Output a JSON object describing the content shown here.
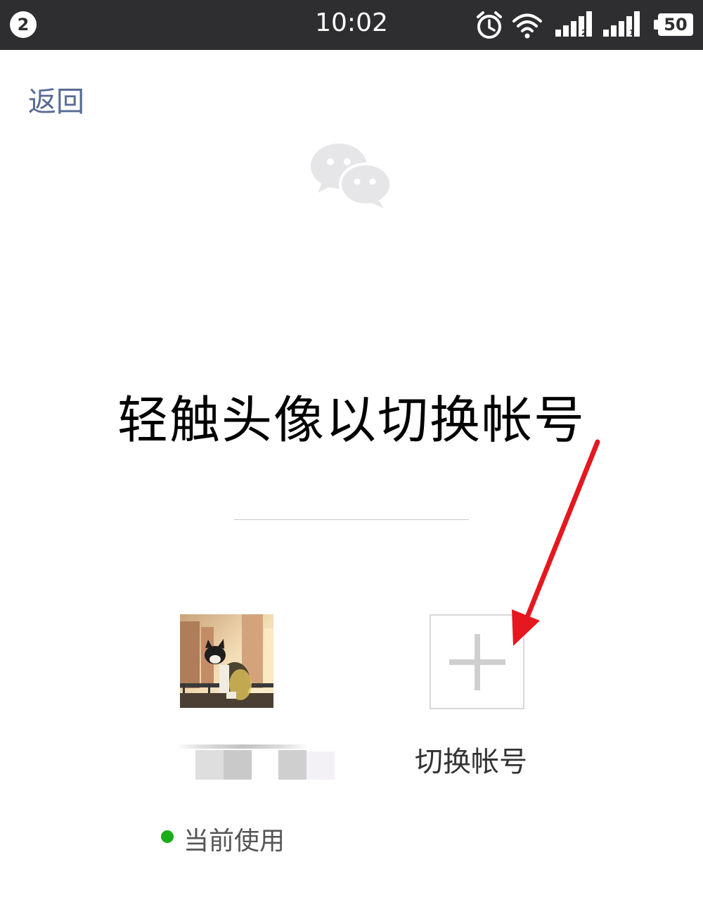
{
  "status_bar": {
    "notification_count": "2",
    "time": "10:02",
    "battery": "50",
    "sim1_label": "2",
    "sim2_label": "1",
    "icons": [
      "alarm-icon",
      "wifi-icon",
      "signal-sim2-icon",
      "signal-sim1-icon",
      "battery-icon"
    ]
  },
  "nav": {
    "back_label": "返回"
  },
  "main": {
    "instruction": "轻触头像以切换帐号",
    "current_account": {
      "status_text": "当前使用",
      "status_color": "#1aad19"
    },
    "add_account": {
      "label": "切换帐号"
    }
  },
  "colors": {
    "status_bar_bg": "#2e2e30",
    "link": "#576b95",
    "active": "#1aad19",
    "annotation_arrow": "#e5171f"
  }
}
